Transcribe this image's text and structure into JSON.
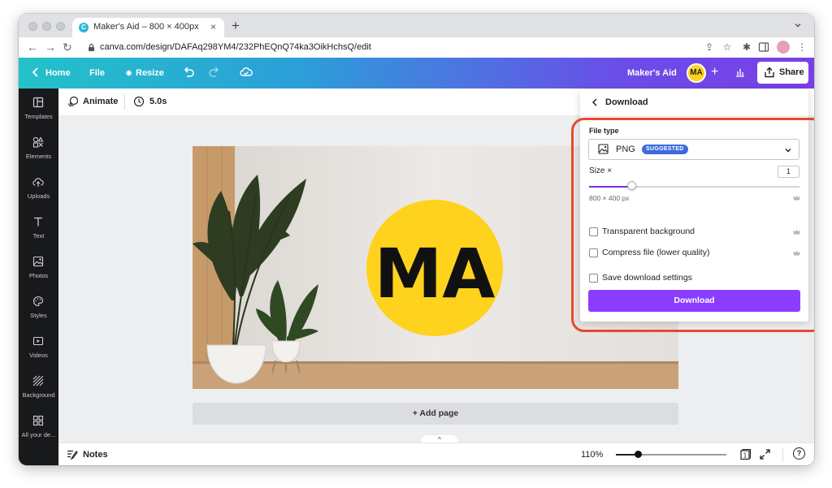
{
  "browser": {
    "tab_title": "Maker's Aid – 800 × 400px",
    "tab_close": "×",
    "new_tab": "+",
    "url": "canva.com/design/DAFAq298YM4/232PhEQnQ74ka3OikHchsQ/edit"
  },
  "header": {
    "home": "Home",
    "file": "File",
    "resize": "Resize",
    "team_name": "Maker's Aid",
    "avatar_initials": "MA",
    "plus": "+",
    "share": "Share"
  },
  "sidebar": {
    "items": [
      {
        "label": "Templates",
        "icon": "templates-icon"
      },
      {
        "label": "Elements",
        "icon": "elements-icon"
      },
      {
        "label": "Uploads",
        "icon": "uploads-icon"
      },
      {
        "label": "Text",
        "icon": "text-icon"
      },
      {
        "label": "Photos",
        "icon": "photos-icon"
      },
      {
        "label": "Styles",
        "icon": "styles-icon"
      },
      {
        "label": "Videos",
        "icon": "videos-icon"
      },
      {
        "label": "Background",
        "icon": "background-icon"
      },
      {
        "label": "All your de...",
        "icon": "all-designs-icon"
      }
    ]
  },
  "toolbar": {
    "animate": "Animate",
    "duration": "5.0s"
  },
  "canvas": {
    "logo_text": "MA",
    "add_page": "+ Add page",
    "collapse": "^"
  },
  "bottom": {
    "notes": "Notes",
    "zoom": "110%",
    "zoom_level": 0.2,
    "page_count": "1",
    "help": "?"
  },
  "download_panel": {
    "title": "Download",
    "file_type_label": "File type",
    "file_type_value": "PNG",
    "suggested_badge": "SUGGESTED",
    "size_label": "Size ×",
    "size_value": "1",
    "size_level": 0.2,
    "dimensions": "800 × 400 px",
    "options": [
      {
        "label": "Transparent background",
        "checked": false,
        "pro": true
      },
      {
        "label": "Compress file (lower quality)",
        "checked": false,
        "pro": true
      },
      {
        "label": "Save download settings",
        "checked": false,
        "pro": false
      }
    ],
    "download_button": "Download"
  },
  "colors": {
    "accent_purple": "#8b3dff",
    "badge_blue": "#3d6ae0",
    "highlight_red": "#e5492f",
    "logo_yellow": "#ffd21e",
    "sidebar_dark": "#18191b"
  }
}
